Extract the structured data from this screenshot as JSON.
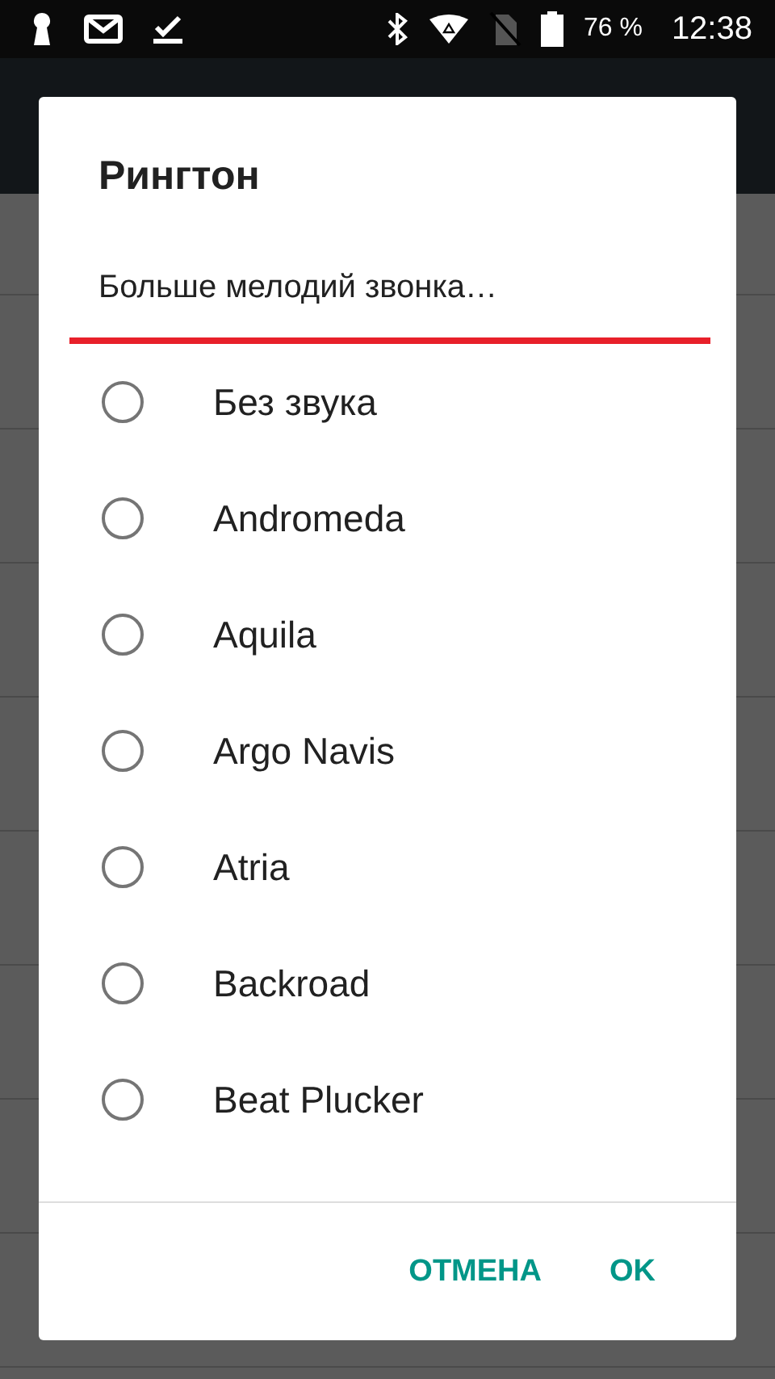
{
  "status_bar": {
    "battery": "76 %",
    "time": "12:38"
  },
  "dialog": {
    "title": "Рингтон",
    "more_link": "Больше мелодий звонка…",
    "options": [
      {
        "label": "Без звука",
        "selected": false
      },
      {
        "label": "Andromeda",
        "selected": false
      },
      {
        "label": "Aquila",
        "selected": false
      },
      {
        "label": "Argo Navis",
        "selected": false
      },
      {
        "label": "Atria",
        "selected": false
      },
      {
        "label": "Backroad",
        "selected": false
      },
      {
        "label": "Beat Plucker",
        "selected": false
      }
    ],
    "buttons": [
      "ОТМЕНА",
      "OK"
    ]
  }
}
